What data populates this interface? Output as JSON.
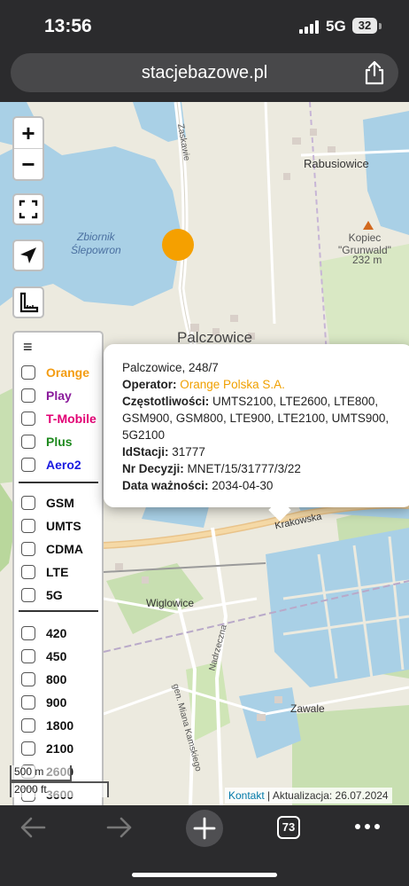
{
  "status_bar": {
    "time": "13:56",
    "network": "5G",
    "battery": "32"
  },
  "browser": {
    "url": "stacjebazowe.pl",
    "tab_count": "73"
  },
  "map": {
    "places": [
      {
        "name": "Rabusiowice"
      },
      {
        "name": "Zbiornik\nŚlepowron"
      },
      {
        "name": "Palczowice"
      },
      {
        "name": "Kopiec\n\"Grunwald\""
      },
      {
        "name": "232 m"
      },
      {
        "name": "Wiglowice"
      },
      {
        "name": "Zawale"
      },
      {
        "name": "Krakowska"
      },
      {
        "name": "Zaskawie"
      },
      {
        "name": "Nadrzeczna"
      },
      {
        "name": "gen. Miana Kamskiego"
      }
    ],
    "zoom_in": "+",
    "zoom_out": "−",
    "scale_metric": "500 m",
    "scale_imperial": "2000 ft",
    "attribution_link": "Kontakt",
    "attribution_text": "| Aktualizacja: 26.07.2024"
  },
  "layers": {
    "menu_icon": "≡",
    "operators": [
      {
        "label": "Orange",
        "color": "#f39c12"
      },
      {
        "label": "Play",
        "color": "#8a1a9b"
      },
      {
        "label": "T-Mobile",
        "color": "#e20074"
      },
      {
        "label": "Plus",
        "color": "#1f8a1f"
      },
      {
        "label": "Aero2",
        "color": "#1a1ae0"
      }
    ],
    "technologies": [
      "GSM",
      "UMTS",
      "CDMA",
      "LTE",
      "5G"
    ],
    "bands": [
      "420",
      "450",
      "800",
      "900",
      "1800",
      "2100",
      "2600",
      "3600"
    ]
  },
  "popup": {
    "title": "Palczowice, 248/7",
    "operator_label": "Operator:",
    "operator_value": "Orange Polska S.A.",
    "freq_label": "Częstotliwości:",
    "freq_value": "UMTS2100, LTE2600, LTE800, GSM900, GSM800, LTE900, LTE2100, UMTS900, 5G2100",
    "id_label": "IdStacji:",
    "id_value": "31777",
    "decision_label": "Nr Decyzji:",
    "decision_value": "MNET/15/31777/3/22",
    "expiry_label": "Data ważności:",
    "expiry_value": "2034-04-30"
  },
  "colors": {
    "marker": "#f5a000",
    "water": "#a9d0e6",
    "forest": "#c8dfb1"
  }
}
